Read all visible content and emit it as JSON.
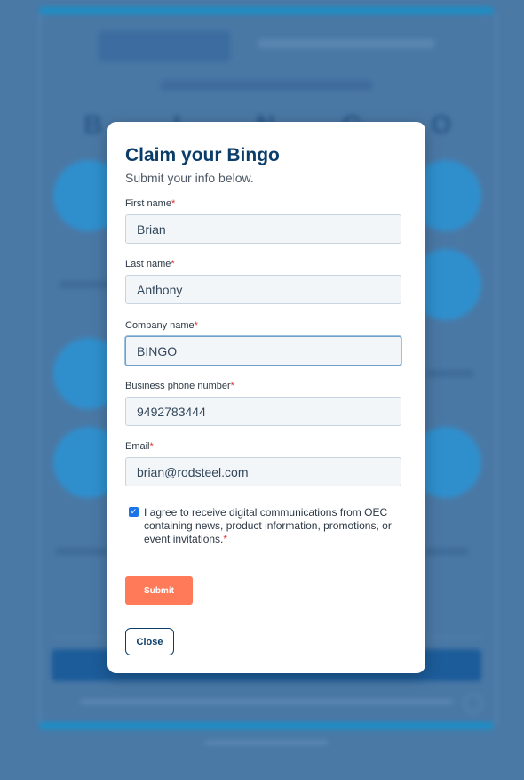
{
  "background": {
    "bingo_letters": [
      "B",
      "I",
      "N",
      "G",
      "O"
    ]
  },
  "modal": {
    "title": "Claim your Bingo",
    "subtitle": "Submit your info below.",
    "required_mark": "*",
    "fields": [
      {
        "label": "First name",
        "value": "Brian"
      },
      {
        "label": "Last name",
        "value": "Anthony"
      },
      {
        "label": "Company name",
        "value": "BINGO"
      },
      {
        "label": "Business phone number",
        "value": "9492783444"
      },
      {
        "label": "Email",
        "value": "brian@rodsteel.com"
      }
    ],
    "consent": {
      "text": "I agree to receive digital communications from OEC containing news, product information, promotions, or event invitations.",
      "checked": true
    },
    "submit_label": "Submit",
    "close_label": "Close"
  }
}
